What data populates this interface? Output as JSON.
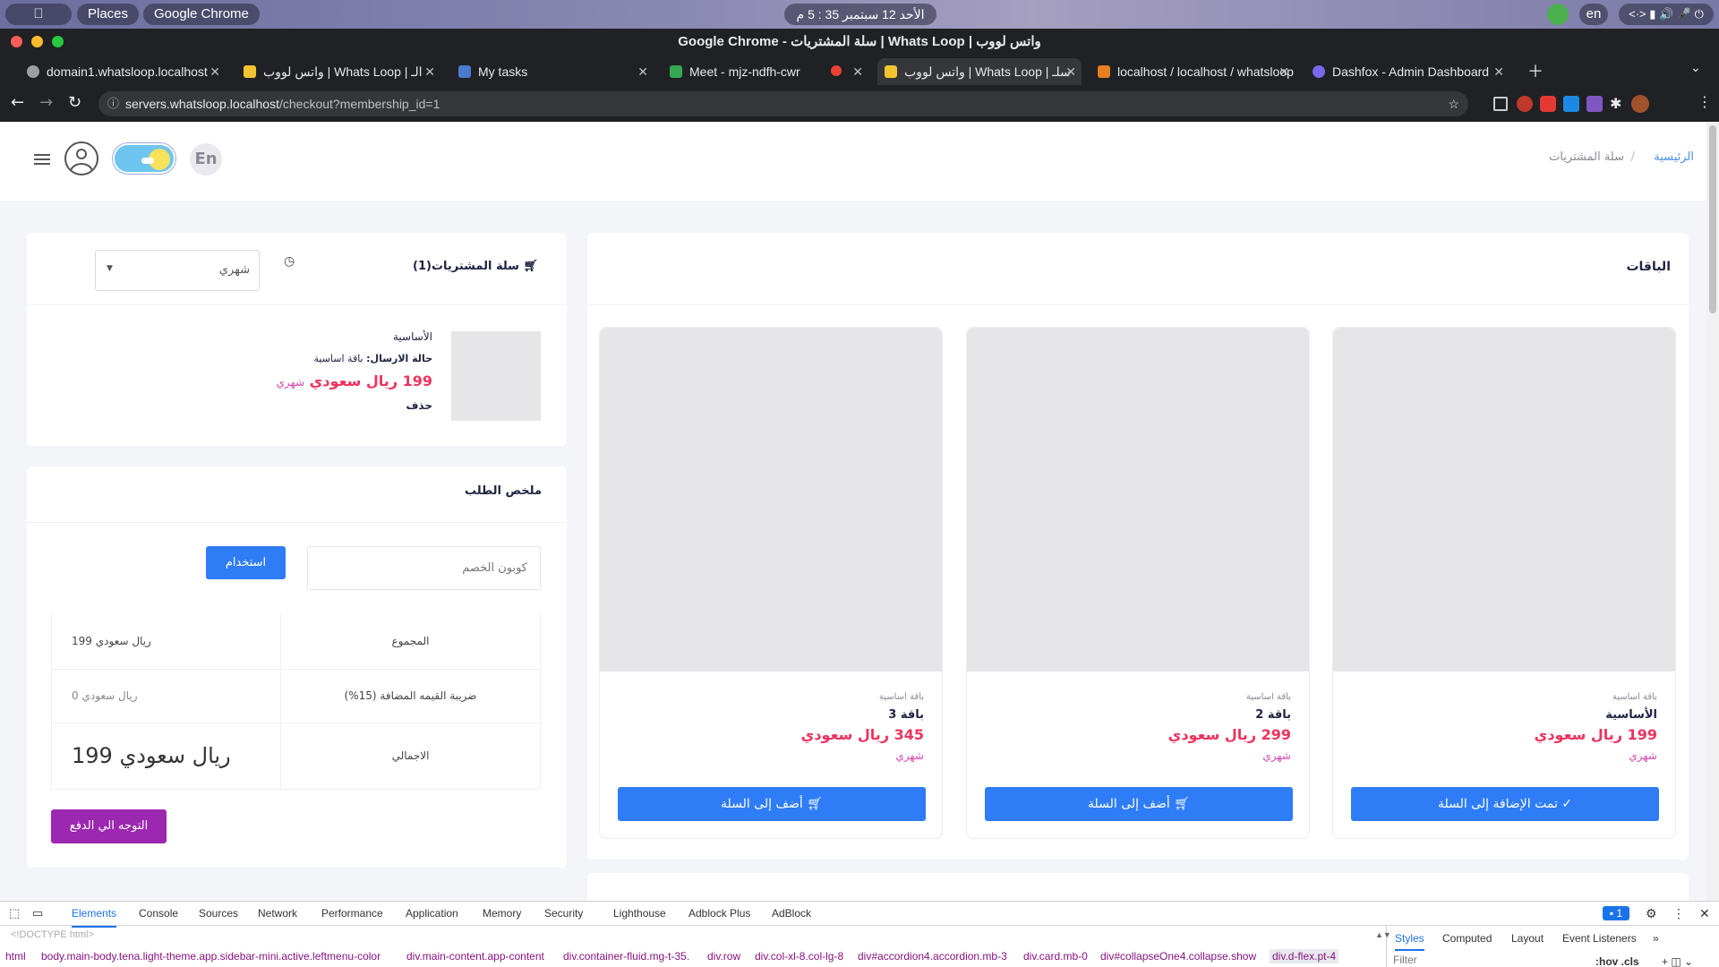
{
  "system_bar": {
    "places": "Places",
    "app": "Google Chrome",
    "clock": "الأحد 12 سبتمبر 35 : 5 م",
    "lang": "en"
  },
  "window_title": "Google Chrome - سلة المشتريات | Whats Loop | واتس لووب",
  "tabs": [
    {
      "label": "domain1.whatsloop.localhost"
    },
    {
      "label": "واتس لووب | Whats Loop | الـ"
    },
    {
      "label": "My tasks"
    },
    {
      "label": "Meet - mjz-ndfh-cwr"
    },
    {
      "label": "واتس لووب | Whats Loop | سلـ"
    },
    {
      "label": "localhost / localhost / whatsloop"
    },
    {
      "label": "Dashfox - Admin Dashboard"
    }
  ],
  "address": {
    "host": "servers.whatsloop.localhost",
    "path": "/checkout?membership_id=1"
  },
  "header": {
    "lang_button": "En",
    "breadcrumb_home": "الرئيسية",
    "breadcrumb_current": "سلة المشتريات"
  },
  "packages": {
    "title": "الباقات",
    "items": [
      {
        "tag": "باقة اساسية",
        "name": "الأساسية",
        "price": "199 ريال سعودي",
        "period": "شهري",
        "button": "تمت الإضافة إلى السلة"
      },
      {
        "tag": "باقة اساسية",
        "name": "باقة 2",
        "price": "299 ريال سعودي",
        "period": "شهري",
        "button": "أضف إلى السلة"
      },
      {
        "tag": "باقة اساسية",
        "name": "باقة 3",
        "price": "345 ريال سعودي",
        "period": "شهري",
        "button": "أضف إلى السلة"
      }
    ]
  },
  "cart": {
    "title": "سلة المشتريات(1)",
    "period_select": "شهري",
    "item": {
      "name": "الأساسية",
      "status_label": "حالة الارسال:",
      "status_value": "باقة اساسية",
      "price": "199 ريال سعودي",
      "period": "شهري",
      "delete": "حذف"
    }
  },
  "summary": {
    "title": "ملخص الطلب",
    "coupon_placeholder": "كوبون الخصم",
    "apply_button": "استخدام",
    "rows": [
      {
        "label": "المجموع",
        "value": "199 ريال سعودي"
      },
      {
        "label": "ضريبة القيمه المضافة (15%)",
        "value": "0 ريال سعودي"
      },
      {
        "label": "الاجمالي",
        "value": "199 ريال سعودي"
      }
    ],
    "checkout_button": "التوجه الي الدفع"
  },
  "devtools": {
    "tabs": [
      "Elements",
      "Console",
      "Sources",
      "Network",
      "Performance",
      "Application",
      "Memory",
      "Security",
      "Lighthouse",
      "Adblock Plus",
      "AdBlock"
    ],
    "doctype": "<!DOCTYPE html>",
    "issues": "1",
    "right_tabs": [
      "Styles",
      "Computed",
      "Layout",
      "Event Listeners"
    ],
    "filter_placeholder": "Filter",
    "filter_tools": ":hov .cls",
    "breadcrumbs": [
      "html",
      "body.main-body.tena.light-theme.app.sidebar-mini.active.leftmenu-color",
      "div.main-content.app-content",
      "div.container-fluid.mg-t-35.",
      "div.row",
      "div.col-xl-8.col-lg-8",
      "div#accordion4.accordion.mb-3",
      "div.card.mb-0",
      "div#collapseOne4.collapse.show",
      "div.d-flex.pt-4"
    ]
  }
}
